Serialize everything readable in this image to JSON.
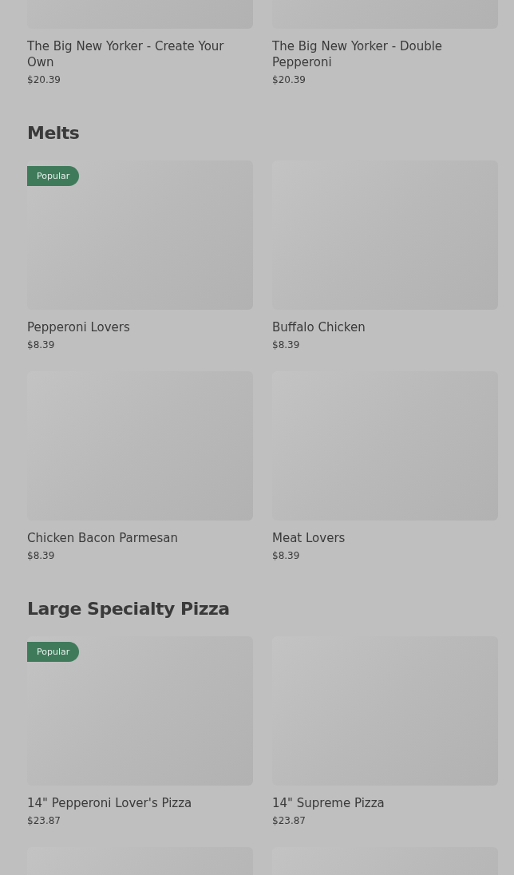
{
  "sections": [
    {
      "items": [
        {
          "kind": "product",
          "name": "The Big New Yorker - Create Your Own",
          "price": "$20.39"
        },
        {
          "kind": "product",
          "name": "The Big New Yorker - Double Pepperoni",
          "price": "$20.39"
        }
      ]
    },
    {
      "title": "Melts",
      "items": [
        {
          "kind": "product",
          "name": "Pepperoni Lovers",
          "price": "$8.39",
          "badge": "Popular"
        },
        {
          "kind": "product",
          "name": "Buffalo Chicken",
          "price": "$8.39"
        },
        {
          "kind": "product",
          "name": "Chicken Bacon Parmesan",
          "price": "$8.39"
        },
        {
          "kind": "product",
          "name": "Meat Lovers",
          "price": "$8.39"
        }
      ]
    },
    {
      "title": "Large Specialty Pizza",
      "items": [
        {
          "kind": "product",
          "name": "14\" Pepperoni Lover's Pizza",
          "price": "$23.87",
          "badge": "Popular"
        },
        {
          "kind": "product",
          "name": "14\" Supreme Pizza",
          "price": "$23.87"
        },
        {
          "kind": "image-only"
        },
        {
          "kind": "image-only"
        }
      ]
    }
  ]
}
